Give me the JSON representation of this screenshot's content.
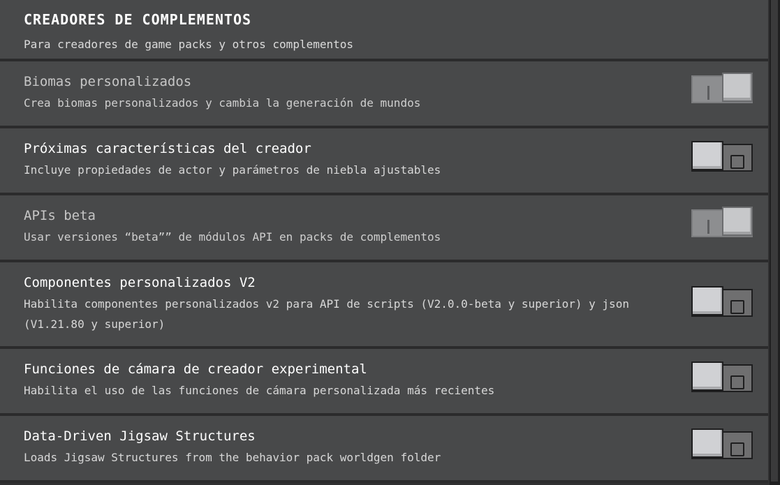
{
  "section": {
    "title": "Creadores de complementos",
    "subtitle": "Para creadores de game packs y otros complementos"
  },
  "toggle_icons": {
    "on_glyph": "toggle-on-bar-icon",
    "off_glyph": "toggle-off-circle-icon"
  },
  "colors": {
    "row_background": "#48494a",
    "page_background": "#2b2b2c",
    "knob": "#d0d1d4"
  },
  "settings": [
    {
      "title": "Biomas personalizados",
      "description": "Crea biomas personalizados y cambia la generación de mundos",
      "state": "on",
      "locked": true
    },
    {
      "title": "Próximas características del creador",
      "description": "Incluye propiedades de actor y parámetros de niebla ajustables",
      "state": "off",
      "locked": false
    },
    {
      "title": "APIs beta",
      "description": "Usar versiones “beta”” de módulos API en packs de complementos",
      "state": "on",
      "locked": true
    },
    {
      "title": "Componentes personalizados V2",
      "description": "Habilita componentes personalizados v2 para API de scripts (V2.0.0-beta y superior) y json (V1.21.80 y superior)",
      "state": "off",
      "locked": false
    },
    {
      "title": "Funciones de cámara de creador experimental",
      "description": "Habilita el uso de las funciones de cámara personalizada más recientes",
      "state": "off",
      "locked": false
    },
    {
      "title": "Data-Driven Jigsaw Structures",
      "description": "Loads Jigsaw Structures from the behavior pack worldgen folder",
      "state": "off",
      "locked": false
    }
  ]
}
